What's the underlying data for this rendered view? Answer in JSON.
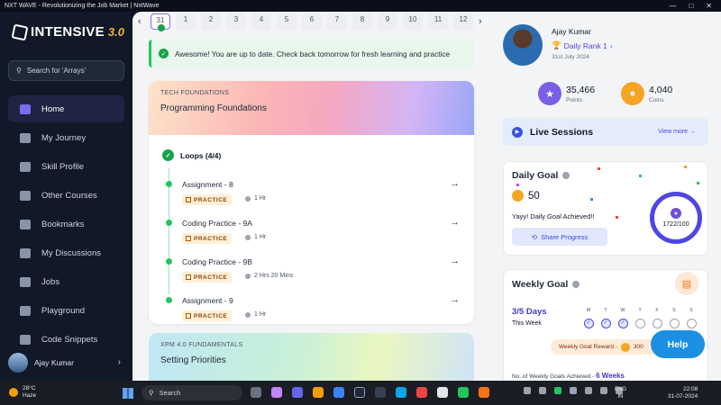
{
  "window": {
    "title": "NXT WAVE - Revolutionizing the Job Market | NxtWave"
  },
  "sidebar": {
    "logo_text": "INTENSIVE",
    "logo_version": "3.0",
    "search_placeholder": "Search for 'Arrays'",
    "items": [
      {
        "label": "Home"
      },
      {
        "label": "My Journey"
      },
      {
        "label": "Skill Profile"
      },
      {
        "label": "Other Courses"
      },
      {
        "label": "Bookmarks"
      },
      {
        "label": "My Discussions"
      },
      {
        "label": "Jobs"
      },
      {
        "label": "Playground"
      },
      {
        "label": "Code Snippets"
      }
    ],
    "user_name": "Ajay Kumar"
  },
  "days": {
    "items": [
      {
        "num": "31",
        "selected": true
      },
      {
        "num": "1"
      },
      {
        "num": "2"
      },
      {
        "num": "3"
      },
      {
        "num": "4"
      },
      {
        "num": "5"
      },
      {
        "num": "6"
      },
      {
        "num": "7"
      },
      {
        "num": "8"
      },
      {
        "num": "9"
      },
      {
        "num": "10"
      },
      {
        "num": "11"
      },
      {
        "num": "12"
      }
    ]
  },
  "toast": {
    "message": "Awesome! You are up to date. Check back tomorrow for fresh learning and practice"
  },
  "course_card": {
    "category": "TECH FOUNDATIONS",
    "title": "Programming Foundations",
    "topic": "Loops (4/4)",
    "items": [
      {
        "name": "Assignment - 8",
        "badge": "PRACTICE",
        "duration": "1 Hr"
      },
      {
        "name": "Coding Practice - 9A",
        "badge": "PRACTICE",
        "duration": "1 Hr"
      },
      {
        "name": "Coding Practice - 9B",
        "badge": "PRACTICE",
        "duration": "2 Hrs 20 Mins"
      },
      {
        "name": "Assignment - 9",
        "badge": "PRACTICE",
        "duration": "1 Hr"
      }
    ]
  },
  "course_card2": {
    "category": "XPM 4.0 FUNDAMENTALS",
    "title": "Setting Priorities"
  },
  "profile": {
    "name": "Ajay Kumar",
    "rank": "Daily Rank 1",
    "date": "31st July 2024"
  },
  "stats": {
    "points": {
      "value": "35,466",
      "label": "Points"
    },
    "coins": {
      "value": "4,040",
      "label": "Coins"
    }
  },
  "live_sessions": {
    "title": "Live Sessions",
    "view_more": "View more"
  },
  "daily_goal": {
    "title": "Daily Goal",
    "coins": "50",
    "message": "Yayy! Daily Goal Achieved!!",
    "share_label": "Share Progress",
    "progress": "1722/100"
  },
  "weekly_goal": {
    "title": "Weekly Goal",
    "days_label": "3/5 Days",
    "this_week": "This Week",
    "weekdays": [
      {
        "d": "M",
        "done": true
      },
      {
        "d": "T",
        "done": true
      },
      {
        "d": "W",
        "done": true
      },
      {
        "d": "T",
        "done": false
      },
      {
        "d": "F",
        "done": false
      },
      {
        "d": "S",
        "done": false
      },
      {
        "d": "S",
        "done": false
      }
    ],
    "reward_label": "Weekly Goal Reward -",
    "reward_value": "300",
    "achieved_label": "No. of Weekly Goals Achieved -",
    "achieved_value": "6 Weeks"
  },
  "help": {
    "label": "Help"
  },
  "taskbar": {
    "temp": "28°C",
    "weather": "Haze",
    "search": "Search",
    "lang1": "ENG",
    "lang2": "IN",
    "time": "22:08",
    "date": "31-07-2024"
  },
  "colors": {
    "accent": "#4f46e5",
    "success": "#22c55e",
    "help": "#1d8fe3"
  }
}
